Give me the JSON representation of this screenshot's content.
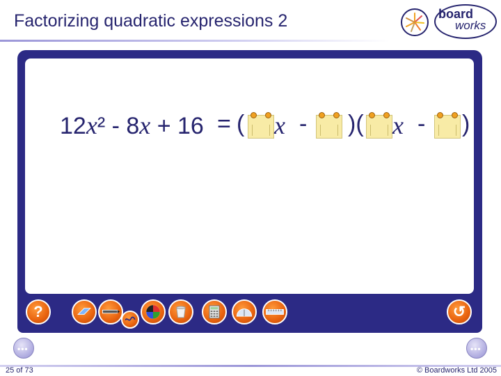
{
  "header": {
    "title": "Factorizing quadratic expressions 2"
  },
  "logo": {
    "line1": "board",
    "line2": "works"
  },
  "equation": {
    "lhs": "12x² - 8x + 16",
    "eq": "=",
    "open1": "(",
    "x1": "x",
    "minus1": "-",
    "close_open": ")(",
    "x2": "x",
    "minus2": "-",
    "close2": ")"
  },
  "toolbar": {
    "help": "?",
    "undo": "↺",
    "tools": [
      "eraser-icon",
      "pen-icon",
      "color-wheel-icon",
      "bin-icon",
      "calculator-icon",
      "protractor-icon",
      "ruler-icon"
    ]
  },
  "footer": {
    "slide_number": "25 of 73",
    "copyright": "© Boardworks Ltd 2005"
  },
  "colors": {
    "navy": "#2c2a85",
    "orange": "#e8620e",
    "note": "#f8eba6"
  }
}
